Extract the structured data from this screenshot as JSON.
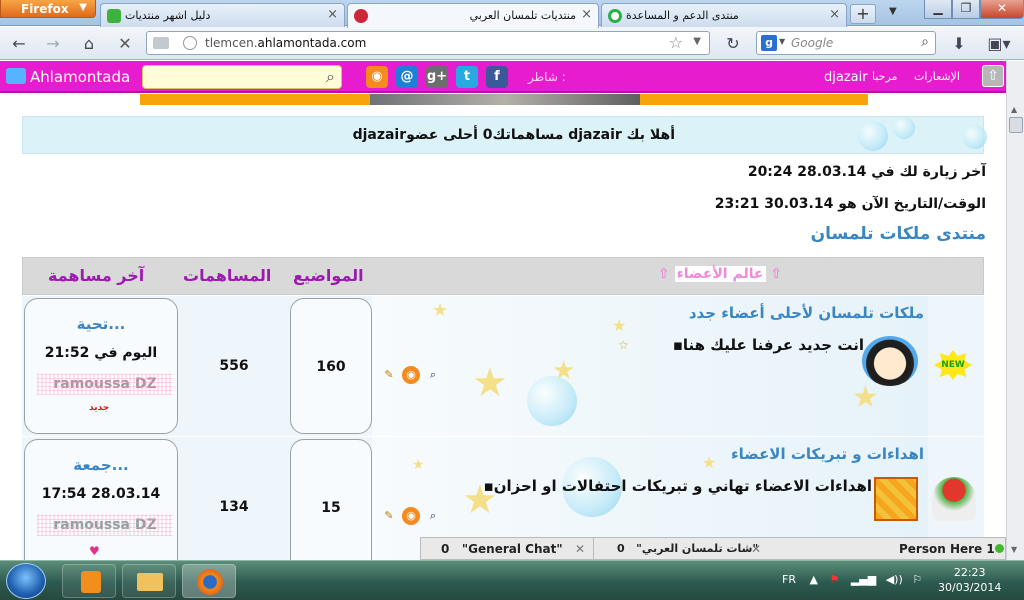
{
  "browser": {
    "app_button": "Firefox",
    "tabs": [
      {
        "label": "دليل اشهر منتديات",
        "icon": "speech-bubble-icon"
      },
      {
        "label": "منتديات تلمسان العربي",
        "icon": "rose-icon",
        "active": true
      },
      {
        "label": "منتدى الدعم و المساعدة",
        "icon": "circle-logo-icon"
      }
    ],
    "url_host_prefix": "tlemcen.",
    "url_host_main": "ahlamontada.com",
    "search_placeholder": "Google"
  },
  "forum_toolbar": {
    "logo_text": "Ahlamontada",
    "share_label": "شاطر :",
    "welcome_text": "مرحبا",
    "username": "djazair",
    "notifications": "الإشعارات",
    "colors": {
      "bar": "#e81ccf",
      "orange": "#f7a30b",
      "title_blue": "#3a86c2",
      "purple": "#9b1ab0"
    }
  },
  "welcome_line": "أهلا بك djazair مساهماتك0 أحلى عضوdjazair",
  "last_visit": "آخر زيارة لك في 28.03.14 20:24",
  "current_time": "الوقت/التاريخ الآن هو 30.03.14 23:21",
  "forum_title": "منتدى ملكات تلمسان",
  "table": {
    "category": "عالم الأعضاء",
    "headers": {
      "topics": "المواضيع",
      "posts": "المساهمات",
      "last_post": "آخر مساهمة"
    },
    "rows": [
      {
        "forum_name": "ملكات تلمسان لأحلى أعضاء جدد",
        "description": "انت جديد عرفنا عليك هنا",
        "topics": "160",
        "posts": "556",
        "last_title": "تحية...",
        "last_time": "اليوم في 21:52",
        "last_user": "ramoussa DZ",
        "badge": "جديد",
        "new_label": "NEW"
      },
      {
        "forum_name": "اهداءات و تبريكات الاعضاء",
        "description": "اهداءات الاعضاء تهاني و تبريكات احتفالات او احزان",
        "topics": "15",
        "posts": "134",
        "last_title": "جمعة...",
        "last_time": "28.03.14 17:54",
        "last_user": "ramoussa DZ",
        "badge": ""
      }
    ]
  },
  "chat": {
    "general": {
      "count": "0",
      "label": "\"General Chat\""
    },
    "arabic": {
      "count": "0",
      "label": "\"شات تلمسان العربي\""
    },
    "people": {
      "label": "Person Here",
      "count": "1"
    }
  },
  "taskbar": {
    "lang": "FR",
    "time": "22:23",
    "date": "30/03/2014"
  }
}
